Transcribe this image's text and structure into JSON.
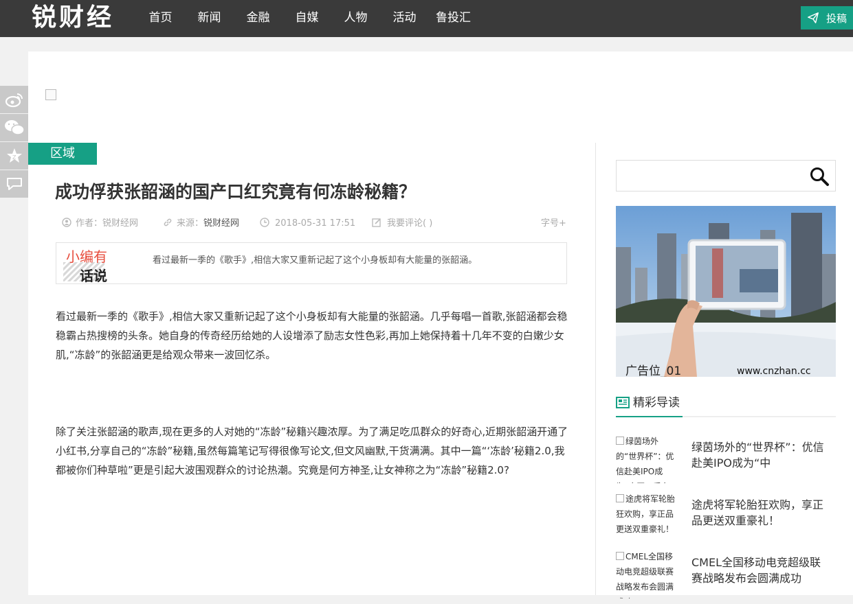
{
  "header": {
    "logo": "锐财经",
    "nav": [
      "首页",
      "新闻",
      "金融",
      "自媒",
      "人物",
      "活动",
      "鲁投汇"
    ],
    "post_label": "投稿"
  },
  "share": [
    "weibo-icon",
    "wechat-icon",
    "favorite-icon",
    "comment-icon"
  ],
  "article": {
    "region_tag": "区域",
    "title": "成功俘获张韶涵的国产口红究竟有何冻龄秘籍？",
    "author": "作者：锐财经网",
    "source_label": "来源：",
    "source": "锐财经网",
    "date": "2018-05-31 17:51",
    "comment": "我要评论( )",
    "font_size": "字号+",
    "editor_badge_line1": "小编有",
    "editor_badge_line2": "话说",
    "summary": "看过最新一季的《歌手》,相信大家又重新记起了这个小身板却有大能量的张韶涵。",
    "paragraphs": [
      "看过最新一季的《歌手》,相信大家又重新记起了这个小身板却有大能量的张韶涵。几乎每唱一首歌,张韶涵都会稳稳霸占热搜榜的头条。她自身的传奇经历给她的人设增添了励志女性色彩,再加上她保持着十几年不变的白嫩少女肌,“冻龄”的张韶涵更是给观众带来一波回忆杀。",
      "除了关注张韶涵的歌声,现在更多的人对她的“冻龄”秘籍兴趣浓厚。为了满足吃瓜群众的好奇心,近期张韶涵开通了小红书,分享自己的“冻龄”秘籍,虽然每篇笔记写得很像写论文,但文风幽默,干货满满。其中一篇“‘冻龄’秘籍2.0,我都被你们种草啦”更是引起大波围观群众的讨论热潮。究竟是何方神圣,让女神称之为“冻龄”秘籍2.0?"
    ]
  },
  "sidebar": {
    "ad_label": "广告位_01",
    "ad_url": "www.cnzhan.cc",
    "section_title": "精彩导读",
    "items": [
      {
        "alt": "绿茵场外的“世界杯”：优信赴美IPO成为“中国二手车电商第一股”",
        "title": "绿茵场外的“世界杯”：优信赴美IPO成为“中"
      },
      {
        "alt": "途虎将军轮胎狂欢购，享正品更送双重豪礼！",
        "title": "途虎将军轮胎狂欢购，享正品更送双重豪礼！"
      },
      {
        "alt": "CMEL全国移动电竞超级联赛战略发布会圆满成功",
        "title": "CMEL全国移动电竞超级联赛战略发布会圆满成功"
      }
    ]
  }
}
